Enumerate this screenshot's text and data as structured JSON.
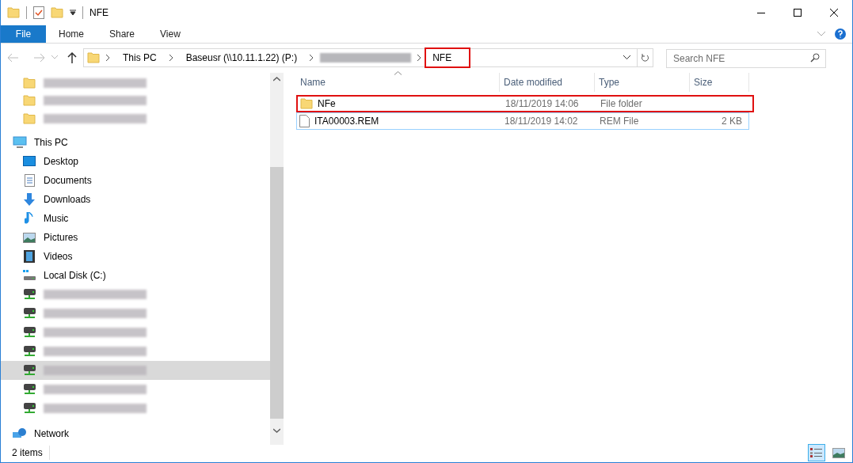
{
  "window": {
    "title": "NFE"
  },
  "ribbon_tabs": [
    {
      "label": "File",
      "selected": true
    },
    {
      "label": "Home",
      "selected": false
    },
    {
      "label": "Share",
      "selected": false
    },
    {
      "label": "View",
      "selected": false
    }
  ],
  "breadcrumbs": [
    {
      "kind": "text",
      "label": "This PC",
      "highlighted": false
    },
    {
      "kind": "text",
      "label": "Baseusr (\\\\10.11.1.22) (P:)",
      "highlighted": false
    },
    {
      "kind": "redacted",
      "highlighted": false
    },
    {
      "kind": "text",
      "label": "NFE",
      "highlighted": true
    }
  ],
  "search": {
    "placeholder": "Search NFE"
  },
  "nav_pane": {
    "quick_access": [
      {
        "kind": "folder",
        "selected": false
      },
      {
        "kind": "folder",
        "selected": false
      },
      {
        "kind": "folder",
        "selected": false
      }
    ],
    "tree": [
      {
        "kind": "pc",
        "label": "This PC",
        "selected": false,
        "children": [
          {
            "kind": "desktop",
            "label": "Desktop",
            "selected": false
          },
          {
            "kind": "documents",
            "label": "Documents",
            "selected": false
          },
          {
            "kind": "downloads",
            "label": "Downloads",
            "selected": false
          },
          {
            "kind": "music",
            "label": "Music",
            "selected": false
          },
          {
            "kind": "pictures",
            "label": "Pictures",
            "selected": false
          },
          {
            "kind": "videos",
            "label": "Videos",
            "selected": false
          },
          {
            "kind": "disk",
            "label": "Local Disk (C:)",
            "selected": false
          },
          {
            "kind": "drive",
            "selected": false
          },
          {
            "kind": "drive",
            "selected": false
          },
          {
            "kind": "drive",
            "selected": false
          },
          {
            "kind": "drive",
            "selected": false
          },
          {
            "kind": "drive",
            "selected": true
          },
          {
            "kind": "drive",
            "selected": false
          },
          {
            "kind": "drive",
            "selected": false
          }
        ]
      },
      {
        "kind": "network",
        "label": "Network",
        "selected": false
      }
    ]
  },
  "file_list": {
    "columns": [
      "Name",
      "Date modified",
      "Type",
      "Size"
    ],
    "rows": [
      {
        "kind": "folder",
        "name": "NFe",
        "date": "18/11/2019 14:06",
        "type": "File folder",
        "highlighted": true
      },
      {
        "kind": "file",
        "name": "ITA00003.REM",
        "date": "18/11/2019 14:02",
        "type": "REM File",
        "size": "2 KB",
        "highlighted": false,
        "focused": true
      }
    ]
  },
  "status_bar": {
    "item_count": "2 items"
  }
}
